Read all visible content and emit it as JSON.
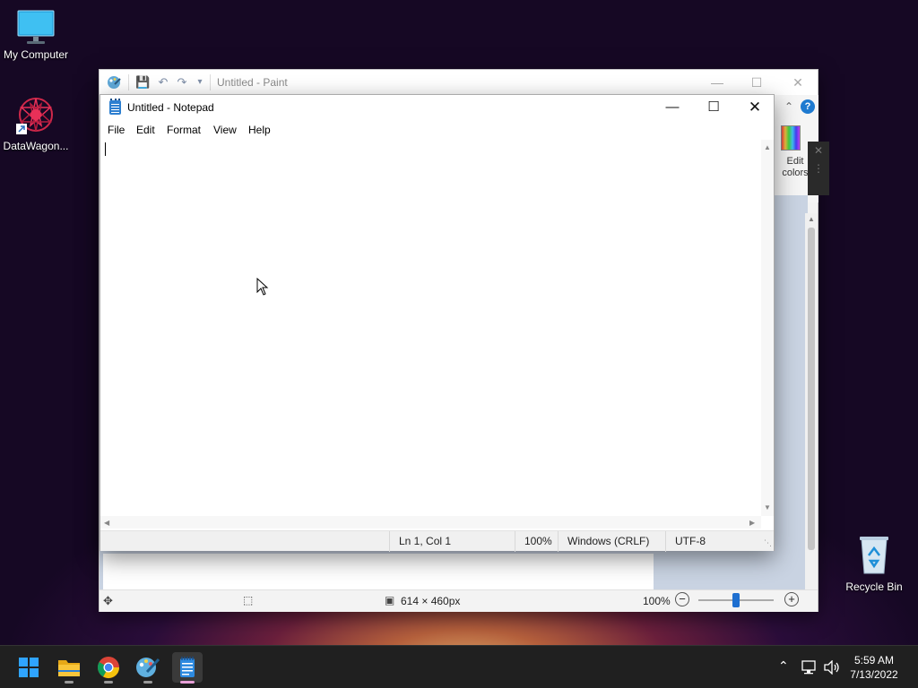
{
  "desktop": {
    "icons": [
      {
        "label": "My Computer"
      },
      {
        "label": "DataWagon..."
      },
      {
        "label": "Recycle Bin"
      }
    ]
  },
  "paint": {
    "title": "Untitled - Paint",
    "ribbon_edit_colors": "Edit colors",
    "status": {
      "size": "614 × 460px",
      "zoom": "100%"
    }
  },
  "notepad": {
    "title": "Untitled - Notepad",
    "menu": [
      "File",
      "Edit",
      "Format",
      "View",
      "Help"
    ],
    "content": "",
    "status": {
      "position": "Ln 1, Col 1",
      "zoom": "100%",
      "line_ending": "Windows (CRLF)",
      "encoding": "UTF-8"
    }
  },
  "taskbar": {
    "apps": [
      "start-icon",
      "file-explorer-icon",
      "chrome-icon",
      "paint-icon",
      "notepad-icon"
    ],
    "active_app": "notepad-icon",
    "clock": {
      "time": "5:59 AM",
      "date": "7/13/2022"
    }
  }
}
